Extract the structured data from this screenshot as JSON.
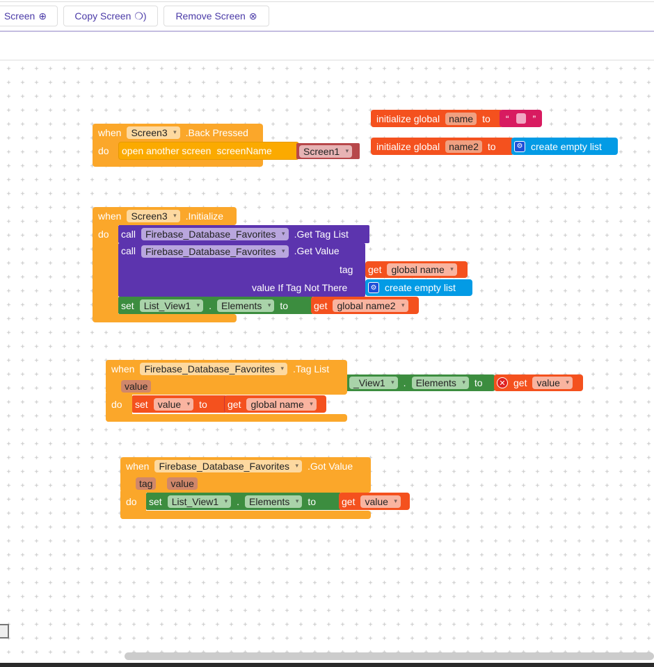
{
  "toolbar": {
    "add_screen": "Screen",
    "add_icon": "⊕",
    "copy_screen": "Copy Screen",
    "copy_icon": "❍)",
    "remove_screen": "Remove Screen",
    "remove_icon": "⊗"
  },
  "colors": {
    "event": "#fba72a",
    "variable": "#f4511e",
    "procedure": "#5c34ae",
    "setter": "#3c8d3f",
    "list": "#039be5",
    "text": "#d81b60",
    "screen": "#b7474a"
  },
  "blocks": {
    "back": {
      "when": "when",
      "component": "Screen3",
      "event": ".Back Pressed",
      "do": "do",
      "action": "open another screen",
      "param": "screenName",
      "value": "Screen1"
    },
    "init1": {
      "label": "initialize global",
      "name": "name",
      "to": "to",
      "open_quote": "“",
      "close_quote": "”"
    },
    "init2": {
      "label": "initialize global",
      "name": "name2",
      "to": "to",
      "list": "create empty list"
    },
    "initialize": {
      "when": "when",
      "component": "Screen3",
      "event": ".Initialize",
      "do": "do",
      "call1": {
        "call": "call",
        "component": "Firebase_Database_Favorites",
        "method": ".Get Tag List"
      },
      "call2": {
        "call": "call",
        "component": "Firebase_Database_Favorites",
        "method": ".Get Value",
        "tag": "tag",
        "tag_get": "get",
        "tag_var": "global name",
        "vitnt": "value If Tag Not There",
        "list": "create empty list"
      },
      "set": {
        "set": "set",
        "component": "List_View1",
        "dot": ".",
        "prop": "Elements",
        "to": "to",
        "get": "get",
        "var": "global name2"
      }
    },
    "taglist": {
      "when": "when",
      "component": "Firebase_Database_Favorites",
      "event": ".Tag List",
      "param": "value",
      "do": "do",
      "set": {
        "set": "set",
        "var": "value",
        "to": "to",
        "get": "get",
        "getvar": "global name"
      },
      "stray": {
        "component": "_View1",
        "dot": ".",
        "prop": "Elements",
        "to": "to",
        "get": "get",
        "var": "value"
      }
    },
    "gotvalue": {
      "when": "when",
      "component": "Firebase_Database_Favorites",
      "event": ".Got Value",
      "param1": "tag",
      "param2": "value",
      "do": "do",
      "set": {
        "set": "set",
        "component": "List_View1",
        "dot": ".",
        "prop": "Elements",
        "to": "to",
        "get": "get",
        "var": "value"
      }
    }
  }
}
